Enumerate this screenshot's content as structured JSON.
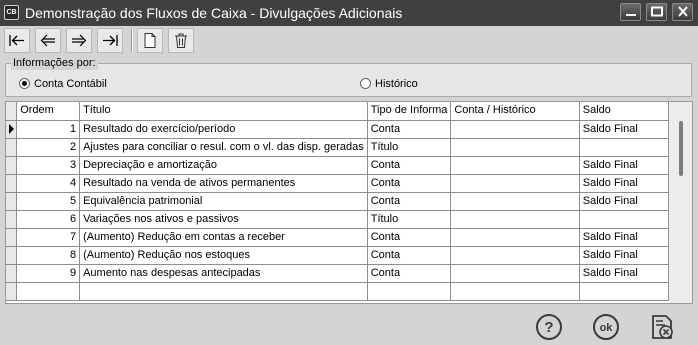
{
  "window": {
    "app_icon_text": "CB",
    "title": "Demonstração dos Fluxos de Caixa - Divulgações Adicionais"
  },
  "toolbar": {
    "icons": [
      "first-record-icon",
      "previous-record-icon",
      "next-record-icon",
      "last-record-icon",
      "new-document-icon",
      "delete-icon"
    ]
  },
  "filter": {
    "legend": "Informações por:",
    "options": [
      {
        "label": "Conta Contábil",
        "selected": true
      },
      {
        "label": "Histórico",
        "selected": false
      }
    ]
  },
  "grid": {
    "columns": [
      "Ordem",
      "Título",
      "Tipo de Informa",
      "Conta / Histórico",
      "Saldo"
    ],
    "rows": [
      {
        "ordem": "1",
        "titulo": "Resultado do exercício/período",
        "tipo": "Conta",
        "conta": "",
        "saldo": "Saldo Final"
      },
      {
        "ordem": "2",
        "titulo": "Ajustes para conciliar o resul. com o vl. das disp. geradas",
        "tipo": "Título",
        "conta": "",
        "saldo": ""
      },
      {
        "ordem": "3",
        "titulo": "Depreciação e amortização",
        "tipo": "Conta",
        "conta": "",
        "saldo": "Saldo Final"
      },
      {
        "ordem": "4",
        "titulo": "Resultado na venda de ativos permanentes",
        "tipo": "Conta",
        "conta": "",
        "saldo": "Saldo Final"
      },
      {
        "ordem": "5",
        "titulo": "Equivalência patrimonial",
        "tipo": "Conta",
        "conta": "",
        "saldo": "Saldo Final"
      },
      {
        "ordem": "6",
        "titulo": "Variações nos ativos e passivos",
        "tipo": "Título",
        "conta": "",
        "saldo": ""
      },
      {
        "ordem": "7",
        "titulo": "(Aumento) Redução em contas a receber",
        "tipo": "Conta",
        "conta": "",
        "saldo": "Saldo Final"
      },
      {
        "ordem": "8",
        "titulo": "(Aumento) Redução nos estoques",
        "tipo": "Conta",
        "conta": "",
        "saldo": "Saldo Final"
      },
      {
        "ordem": "9",
        "titulo": "Aumento nas despesas antecipadas",
        "tipo": "Conta",
        "conta": "",
        "saldo": "Saldo Final"
      }
    ],
    "current_row": 0
  },
  "footer": {
    "icons": [
      "help-icon",
      "ok-icon",
      "cancel-icon"
    ]
  },
  "colors": {
    "titlebar": "#404040",
    "window": "#d4d4d4"
  }
}
